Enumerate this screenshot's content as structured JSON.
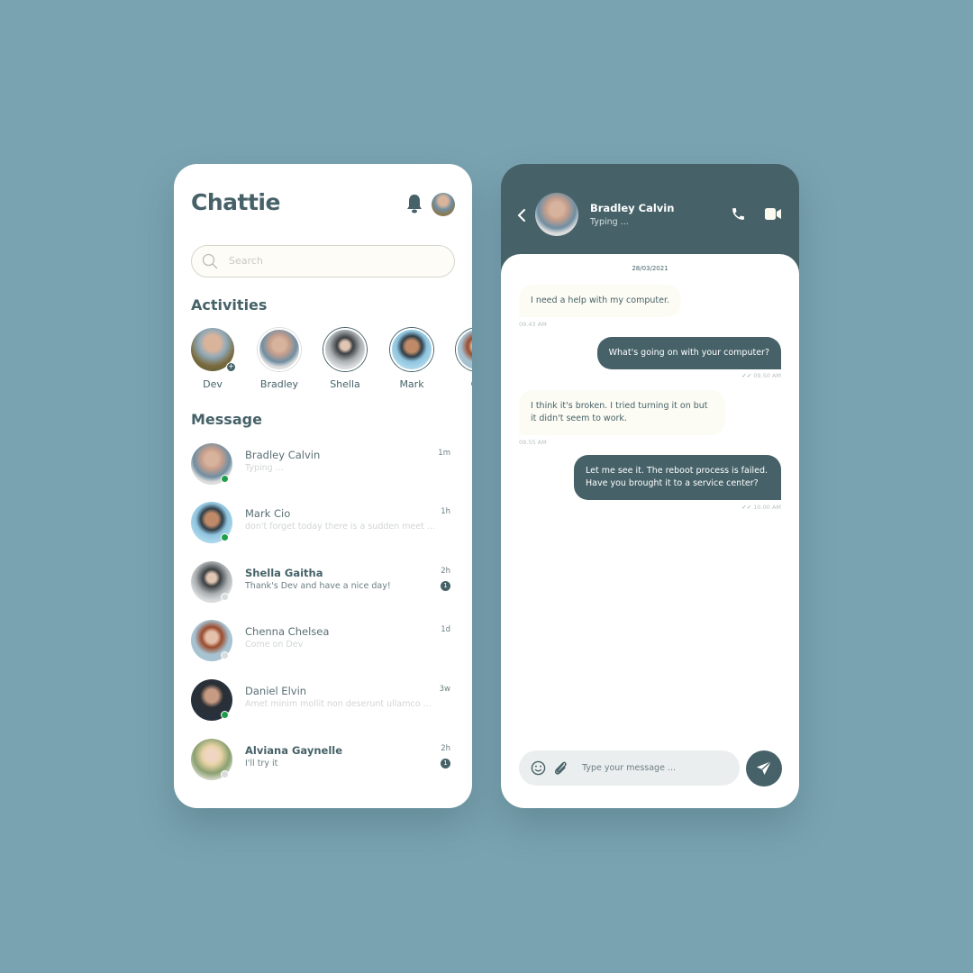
{
  "colors": {
    "primary": "#466268",
    "background": "#7aa3b1",
    "online": "#1e9e48",
    "offline": "#d9dcdc"
  },
  "list": {
    "app_title": "Chattie",
    "search_placeholder": "Search",
    "activities_heading": "Activities",
    "activities": [
      {
        "label": "Dev"
      },
      {
        "label": "Bradley"
      },
      {
        "label": "Shella"
      },
      {
        "label": "Mark"
      },
      {
        "label": "Ch"
      }
    ],
    "message_heading": "Message",
    "messages": [
      {
        "name": "Bradley  Calvin",
        "preview": "Typing ...",
        "time": "1m",
        "online": true
      },
      {
        "name": "Mark Cio",
        "preview": "don't forget today there is a sudden meet ...",
        "time": "1h",
        "online": true
      },
      {
        "name": "Shella Gaitha",
        "preview": "Thank's Dev and have a nice day!",
        "time": "2h",
        "unread": "1",
        "online": false
      },
      {
        "name": "Chenna Chelsea",
        "preview": "Come on Dev",
        "time": "1d",
        "online": false
      },
      {
        "name": "Daniel Elvin",
        "preview": "Amet minim mollit non deserunt ullamco ...",
        "time": "3w",
        "online": true
      },
      {
        "name": "Alviana Gaynelle",
        "preview": "I'll try it",
        "time": "2h",
        "unread": "1",
        "online": false
      }
    ]
  },
  "chat": {
    "contact_name": "Bradley Calvin",
    "status": "Typing ...",
    "date": "28/03/2021",
    "messages": [
      {
        "text": "I need a help with my computer.",
        "time": "09.43 AM",
        "side": "received"
      },
      {
        "text": "What's going on with your computer?",
        "time": "09.50 AM",
        "side": "sent"
      },
      {
        "text": "I think it's broken. I tried turning it on but it didn't seem to work.",
        "time": "09.55 AM",
        "side": "received"
      },
      {
        "text": "Let me see it. The reboot process is failed. Have you brought it to a service center?",
        "time": "10.00 AM",
        "side": "sent"
      }
    ],
    "input_placeholder": "Type your message ..."
  }
}
